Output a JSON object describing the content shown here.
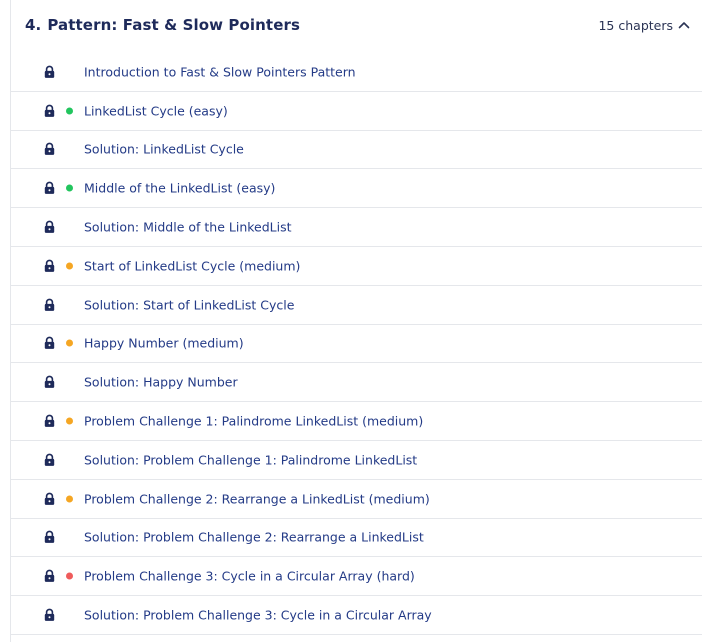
{
  "section": {
    "number": "4.",
    "title": "Pattern: Fast & Slow Pointers",
    "chapter_count": "15",
    "chapter_word": "chapters",
    "expanded": true
  },
  "colors": {
    "easy": "#22c55e",
    "medium": "#f5a623",
    "hard": "#ef5b5b",
    "lock": "#1e2a5a"
  },
  "lessons": [
    {
      "title": "Introduction to Fast & Slow Pointers Pattern",
      "difficulty": "",
      "locked": true
    },
    {
      "title": "LinkedList Cycle (easy)",
      "difficulty": "easy",
      "locked": true
    },
    {
      "title": "Solution: LinkedList Cycle",
      "difficulty": "",
      "locked": true
    },
    {
      "title": "Middle of the LinkedList (easy)",
      "difficulty": "easy",
      "locked": true
    },
    {
      "title": "Solution: Middle of the LinkedList",
      "difficulty": "",
      "locked": true
    },
    {
      "title": "Start of LinkedList Cycle (medium)",
      "difficulty": "medium",
      "locked": true
    },
    {
      "title": "Solution: Start of LinkedList Cycle",
      "difficulty": "",
      "locked": true
    },
    {
      "title": "Happy Number (medium)",
      "difficulty": "medium",
      "locked": true
    },
    {
      "title": "Solution: Happy Number",
      "difficulty": "",
      "locked": true
    },
    {
      "title": "Problem Challenge 1: Palindrome LinkedList (medium)",
      "difficulty": "medium",
      "locked": true
    },
    {
      "title": "Solution: Problem Challenge 1: Palindrome LinkedList",
      "difficulty": "",
      "locked": true
    },
    {
      "title": "Problem Challenge 2: Rearrange a LinkedList (medium)",
      "difficulty": "medium",
      "locked": true
    },
    {
      "title": "Solution: Problem Challenge 2: Rearrange a LinkedList",
      "difficulty": "",
      "locked": true
    },
    {
      "title": "Problem Challenge 3: Cycle in a Circular Array (hard)",
      "difficulty": "hard",
      "locked": true
    },
    {
      "title": "Solution: Problem Challenge 3: Cycle in a Circular Array",
      "difficulty": "",
      "locked": true
    }
  ]
}
